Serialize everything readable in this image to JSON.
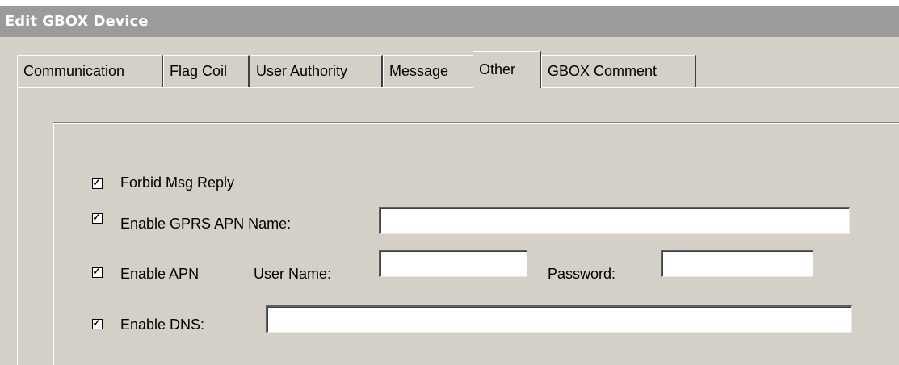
{
  "window": {
    "title": "Edit GBOX Device"
  },
  "tabs": [
    {
      "label": "Communication",
      "active": false
    },
    {
      "label": "Flag Coil",
      "active": false
    },
    {
      "label": "User Authority",
      "active": false
    },
    {
      "label": "Message",
      "active": false
    },
    {
      "label": "Other",
      "active": true
    },
    {
      "label": "GBOX Comment",
      "active": false
    }
  ],
  "other": {
    "forbid_msg_reply": {
      "label": "Forbid Msg Reply",
      "checked": true
    },
    "enable_gprs_apn_name": {
      "label": "Enable GPRS APN Name:",
      "checked": true,
      "value": ""
    },
    "enable_apn": {
      "label": "Enable APN",
      "checked": true,
      "user_name_label": "User Name:",
      "user_name_value": "",
      "password_label": "Password:",
      "password_value": ""
    },
    "enable_dns": {
      "label": "Enable DNS:",
      "checked": true,
      "value": ""
    }
  }
}
